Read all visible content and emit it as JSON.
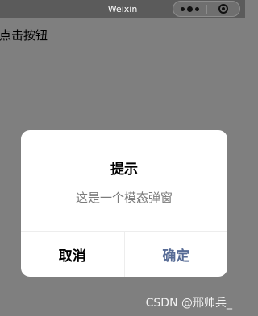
{
  "nav": {
    "title": "Weixin",
    "more_icon": "more-dots-icon",
    "close_icon": "target-close-icon"
  },
  "page": {
    "button_text": "点击按钮"
  },
  "modal": {
    "title": "提示",
    "content": "这是一个模态弹窗",
    "cancel_label": "取消",
    "confirm_label": "确定"
  },
  "watermark": "CSDN @邢帅兵_",
  "colors": {
    "confirm": "#576b95",
    "mask": "#7f7f7f",
    "nav_bg": "#5b5b5b"
  }
}
